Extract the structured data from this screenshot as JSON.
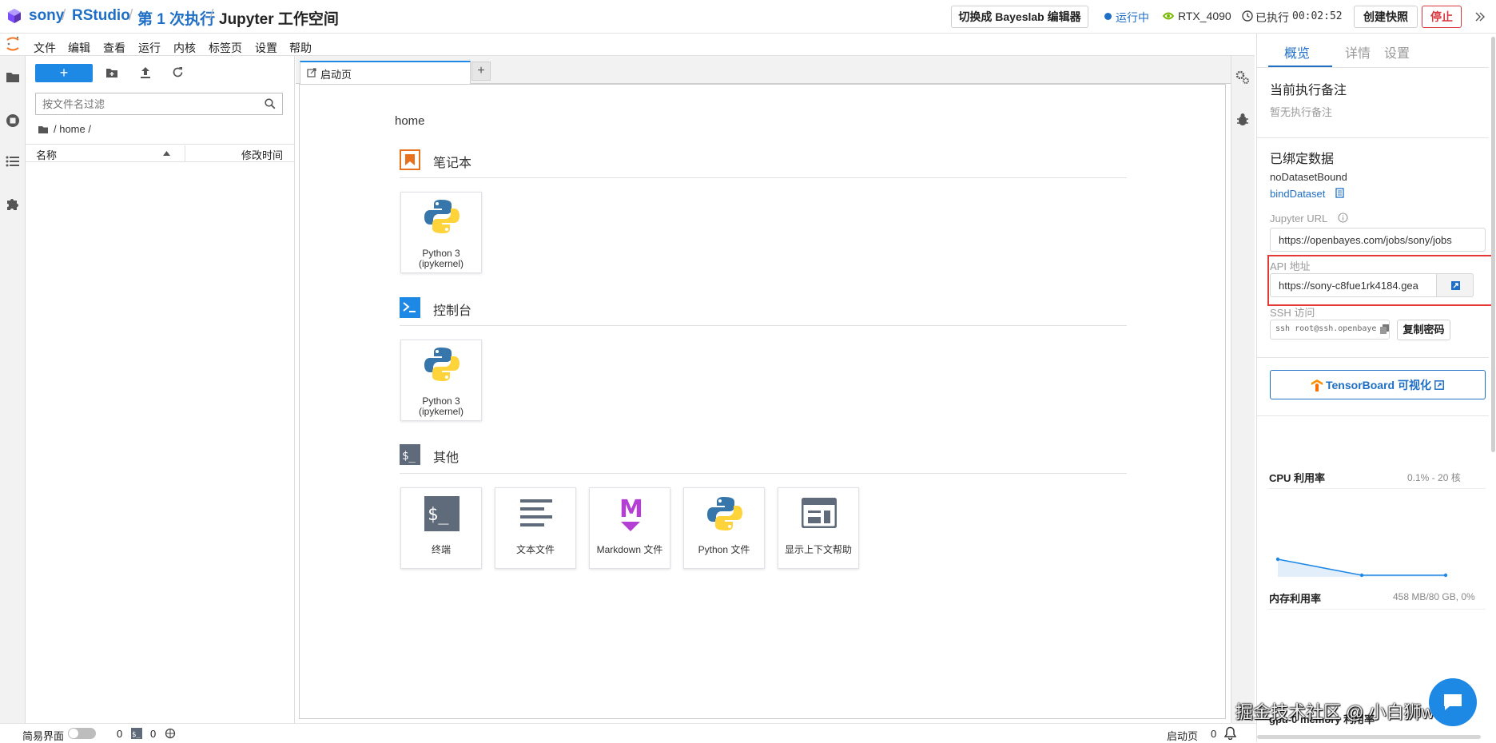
{
  "topbar": {
    "crumb_user": "sony",
    "crumb_project": "RStudio",
    "crumb_run": "第 1 次执行",
    "crumb_page": "Jupyter 工作空间",
    "switch_editor": "切换成 Bayeslab 编辑器",
    "status": "运行中",
    "gpu": "RTX_4090",
    "elapsed_label": "已执行",
    "elapsed": "00:02:52",
    "snapshot": "创建快照",
    "stop": "停止"
  },
  "menu": [
    "文件",
    "编辑",
    "查看",
    "运行",
    "内核",
    "标签页",
    "设置",
    "帮助"
  ],
  "filebrowser": {
    "filter_placeholder": "按文件名过滤",
    "path": "/ home /",
    "col_name": "名称",
    "col_modified": "修改时间"
  },
  "tab": {
    "label": "启动页"
  },
  "launcher": {
    "cwd": "home",
    "sections": {
      "notebook": "笔记本",
      "console": "控制台",
      "other": "其他"
    },
    "kernel_name": "Python 3",
    "kernel_sub": "(ipykernel)",
    "other_items": [
      "终端",
      "文本文件",
      "Markdown 文件",
      "Python 文件",
      "显示上下文帮助"
    ]
  },
  "right": {
    "tabs": [
      "概览",
      "详情",
      "设置"
    ],
    "note_title": "当前执行备注",
    "note_value": "暂无执行备注",
    "dataset_title": "已绑定数据",
    "dataset_value": "noDatasetBound",
    "bind_link": "bindDataset",
    "jupyter_url_label": "Jupyter URL",
    "jupyter_url": "https://openbayes.com/jobs/sony/jobs",
    "api_label": "API 地址",
    "api_url": "https://sony-c8fue1rk4184.gea",
    "ssh_label": "SSH 访问",
    "ssh_value": "ssh root@ssh.openbaye",
    "copy_password": "复制密码",
    "tensorboard": "TensorBoard 可视化",
    "cpu_title": "CPU 利用率",
    "cpu_value": "0.1% - 20 核",
    "mem_title": "内存利用率",
    "mem_value": "458 MB/80 GB, 0%",
    "gpu_util_title": "gpu-0 memory 利用率"
  },
  "statusbar": {
    "simple_mode": "简易界面",
    "count1": "0",
    "count2": "0",
    "right_label": "启动页",
    "right_count": "0"
  },
  "watermark": "掘金技术社区 @ 小白狮www",
  "colors": {
    "accent": "#1f6fc6",
    "stop": "#d9363e",
    "highlight": "#e53935",
    "launcher_orange": "#e8711e",
    "console_blue": "#1e88e5",
    "md_purple": "#b33fd4"
  },
  "cpu_series": [
    0.55,
    0.05,
    0.05
  ],
  "mem_series": [
    0.0,
    0.0,
    0.0
  ]
}
